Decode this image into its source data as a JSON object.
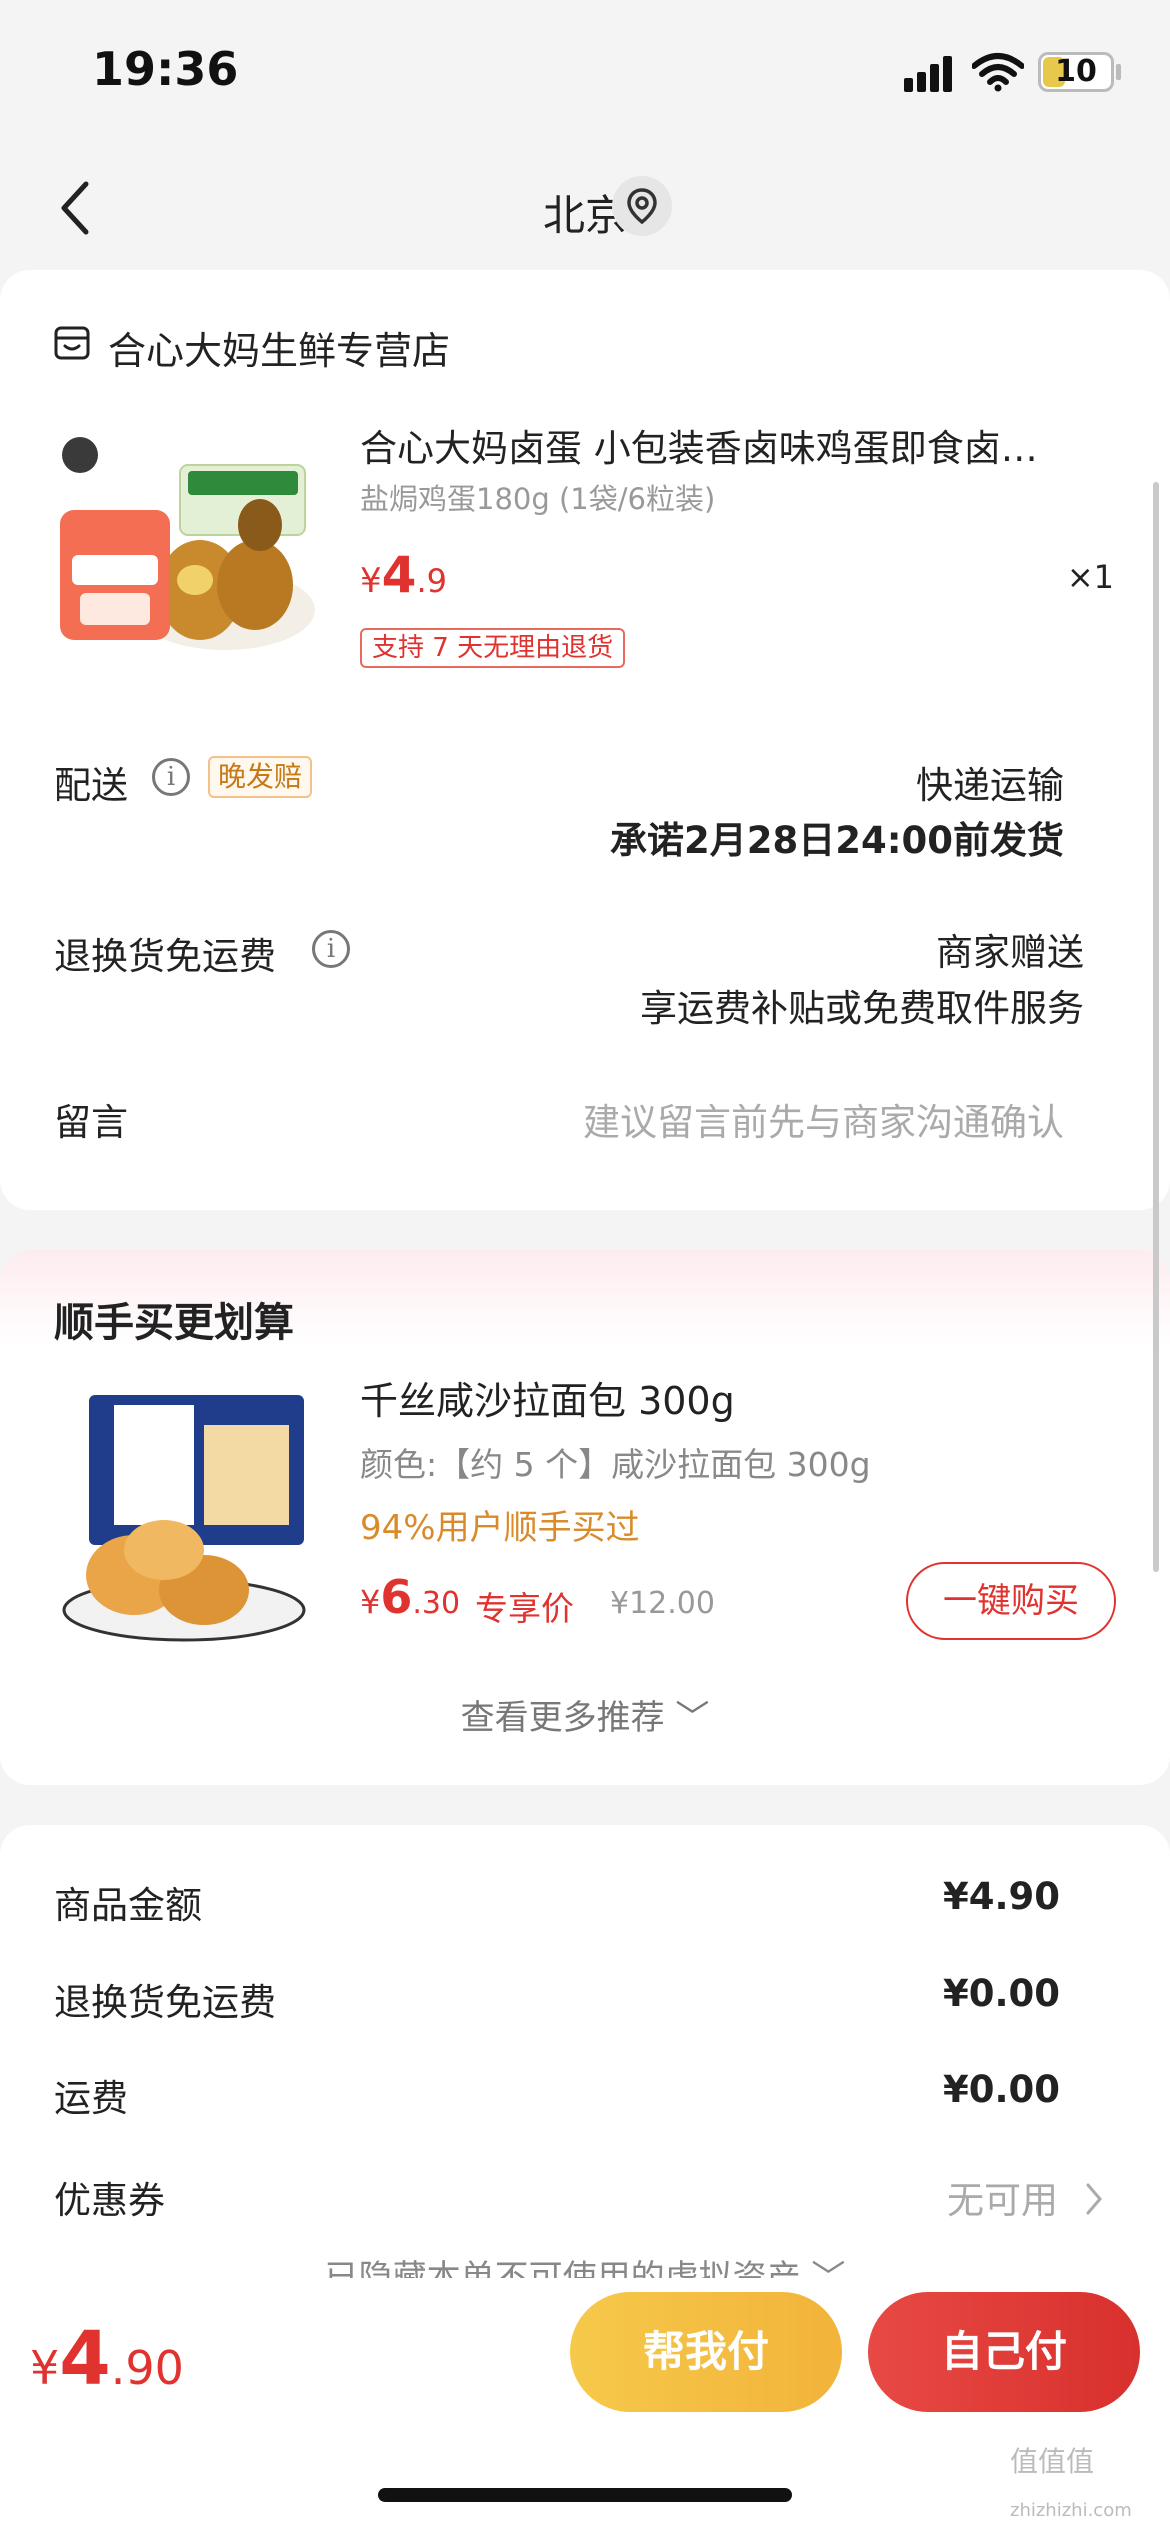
{
  "status_bar": {
    "time": "19:36",
    "battery": "10"
  },
  "nav": {
    "title": "北京"
  },
  "order_card": {
    "store_name": "合心大妈生鲜专营店",
    "product": {
      "title": "合心大妈卤蛋 小包装香卤味鸡蛋即食卤…",
      "spec": "盐焗鸡蛋180g (1袋/6粒装)",
      "price_symbol": "¥",
      "price_int": "4",
      "price_dec": ".9",
      "quantity": "×1",
      "return_tag": "支持 7 天无理由退货"
    },
    "delivery": {
      "label": "配送",
      "tag": "晚发赔",
      "method": "快递运输",
      "promise": "承诺2月28日24:00前发货"
    },
    "return_shipping": {
      "label": "退换货免运费",
      "value": "商家赠送",
      "detail": "享运费补贴或免费取件服务"
    },
    "message": {
      "label": "留言",
      "placeholder": "建议留言前先与商家沟通确认"
    }
  },
  "recommend": {
    "title": "顺手买更划算",
    "item": {
      "name": "千丝咸沙拉面包 300g",
      "color": "颜色:【约 5 个】咸沙拉面包 300g",
      "buyers": "94%用户顺手买过",
      "price_symbol": "¥",
      "price_int": "6",
      "price_dec": ".30",
      "exclusive": "专享价",
      "original_price": "¥12.00",
      "button": "一键购买"
    },
    "more": "查看更多推荐 ﹀"
  },
  "summary": {
    "rows": [
      {
        "label": "商品金额",
        "value": "¥4.90"
      },
      {
        "label": "退换货免运费",
        "value": "¥0.00"
      },
      {
        "label": "运费",
        "value": "¥0.00"
      }
    ],
    "coupon": {
      "label": "优惠券",
      "value": "无可用"
    },
    "hidden_assets": "已隐藏本单不可使用的虚拟资产 ﹀"
  },
  "bottom_bar": {
    "price_symbol": "¥",
    "price_int": "4",
    "price_dec": ".90",
    "help_pay": "帮我付",
    "self_pay": "自己付"
  },
  "watermark": {
    "main": "值值值",
    "sub": "zhizhizhi.com"
  },
  "colors": {
    "accent": "#e0322e",
    "gold": "#f2b33a",
    "late_tag": "#c57a16"
  },
  "icons": [
    "back-icon",
    "location-icon",
    "store-icon",
    "info-icon",
    "chevron-right-icon",
    "signal-icon",
    "wifi-icon",
    "battery-icon"
  ]
}
